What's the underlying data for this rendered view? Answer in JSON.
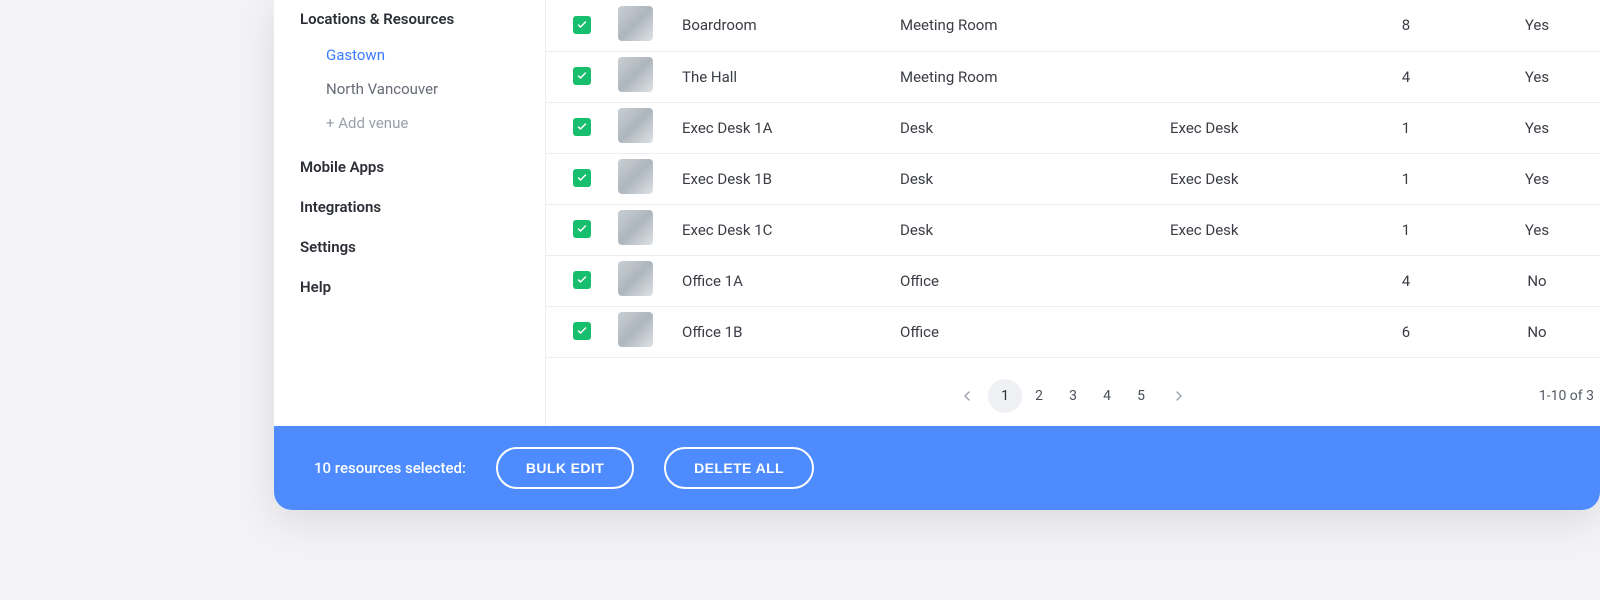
{
  "sidebar": {
    "heading": "Locations & Resources",
    "venues": [
      {
        "label": "Gastown",
        "active": true
      },
      {
        "label": "North Vancouver",
        "active": false
      }
    ],
    "add_venue": "+ Add venue",
    "items": [
      {
        "label": "Mobile Apps"
      },
      {
        "label": "Integrations"
      },
      {
        "label": "Settings"
      },
      {
        "label": "Help"
      }
    ]
  },
  "resources": [
    {
      "name": "Boardroom",
      "type": "Meeting Room",
      "group": "",
      "capacity": "8",
      "available": "Yes"
    },
    {
      "name": "The Hall",
      "type": "Meeting Room",
      "group": "",
      "capacity": "4",
      "available": "Yes"
    },
    {
      "name": "Exec Desk 1A",
      "type": "Desk",
      "group": "Exec Desk",
      "capacity": "1",
      "available": "Yes"
    },
    {
      "name": "Exec Desk 1B",
      "type": "Desk",
      "group": "Exec Desk",
      "capacity": "1",
      "available": "Yes"
    },
    {
      "name": "Exec Desk 1C",
      "type": "Desk",
      "group": "Exec Desk",
      "capacity": "1",
      "available": "Yes"
    },
    {
      "name": "Office 1A",
      "type": "Office",
      "group": "",
      "capacity": "4",
      "available": "No"
    },
    {
      "name": "Office 1B",
      "type": "Office",
      "group": "",
      "capacity": "6",
      "available": "No"
    }
  ],
  "pagination": {
    "pages": [
      "1",
      "2",
      "3",
      "4",
      "5"
    ],
    "active": "1",
    "range": "1-10 of 3"
  },
  "selection_bar": {
    "label": "10 resources selected:",
    "bulk_edit": "BULK EDIT",
    "delete_all": "DELETE ALL"
  }
}
